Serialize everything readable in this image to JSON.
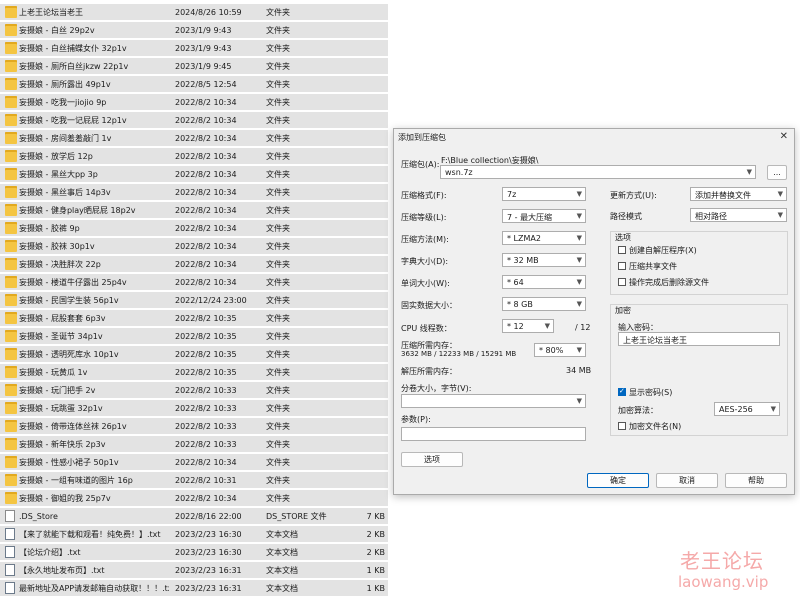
{
  "files": [
    {
      "icon": "folder",
      "name": "上老王论坛当老王",
      "date": "2024/8/26 10:59",
      "type": "文件夹",
      "size": ""
    },
    {
      "icon": "folder",
      "name": "妄摄娘 - 白丝 29p2v",
      "date": "2023/1/9 9:43",
      "type": "文件夹",
      "size": ""
    },
    {
      "icon": "folder",
      "name": "妄摄娘 - 白丝捕蝶女仆 32p1v",
      "date": "2023/1/9 9:43",
      "type": "文件夹",
      "size": ""
    },
    {
      "icon": "folder",
      "name": "妄摄娘 - 厕所白丝jkzw 22p1v",
      "date": "2023/1/9 9:45",
      "type": "文件夹",
      "size": ""
    },
    {
      "icon": "folder",
      "name": "妄摄娘 - 厕所露出 49p1v",
      "date": "2022/8/5 12:54",
      "type": "文件夹",
      "size": ""
    },
    {
      "icon": "folder",
      "name": "妄摄娘 - 吃我一jiojio 9p",
      "date": "2022/8/2 10:34",
      "type": "文件夹",
      "size": ""
    },
    {
      "icon": "folder",
      "name": "妄摄娘 - 吃我一记屁屁 12p1v",
      "date": "2022/8/2 10:34",
      "type": "文件夹",
      "size": ""
    },
    {
      "icon": "folder",
      "name": "妄摄娘 - 房间羞羞敲门 1v",
      "date": "2022/8/2 10:34",
      "type": "文件夹",
      "size": ""
    },
    {
      "icon": "folder",
      "name": "妄摄娘 - 放学后 12p",
      "date": "2022/8/2 10:34",
      "type": "文件夹",
      "size": ""
    },
    {
      "icon": "folder",
      "name": "妄摄娘 - 黑丝大pp 3p",
      "date": "2022/8/2 10:34",
      "type": "文件夹",
      "size": ""
    },
    {
      "icon": "folder",
      "name": "妄摄娘 - 黑丝事后 14p3v",
      "date": "2022/8/2 10:34",
      "type": "文件夹",
      "size": ""
    },
    {
      "icon": "folder",
      "name": "妄摄娘 - 健身play晒屁屁 18p2v",
      "date": "2022/8/2 10:34",
      "type": "文件夹",
      "size": ""
    },
    {
      "icon": "folder",
      "name": "妄摄娘 - 胶裤 9p",
      "date": "2022/8/2 10:34",
      "type": "文件夹",
      "size": ""
    },
    {
      "icon": "folder",
      "name": "妄摄娘 - 胶袜 30p1v",
      "date": "2022/8/2 10:34",
      "type": "文件夹",
      "size": ""
    },
    {
      "icon": "folder",
      "name": "妄摄娘 - 决胜胖次 22p",
      "date": "2022/8/2 10:34",
      "type": "文件夹",
      "size": ""
    },
    {
      "icon": "folder",
      "name": "妄摄娘 - 楼道牛仔露出 25p4v",
      "date": "2022/8/2 10:34",
      "type": "文件夹",
      "size": ""
    },
    {
      "icon": "folder",
      "name": "妄摄娘 - 民国学生装 56p1v",
      "date": "2022/12/24 23:00",
      "type": "文件夹",
      "size": ""
    },
    {
      "icon": "folder",
      "name": "妄摄娘 - 屁股套套 6p3v",
      "date": "2022/8/2 10:35",
      "type": "文件夹",
      "size": ""
    },
    {
      "icon": "folder",
      "name": "妄摄娘 - 圣诞节 34p1v",
      "date": "2022/8/2 10:35",
      "type": "文件夹",
      "size": ""
    },
    {
      "icon": "folder",
      "name": "妄摄娘 - 透明死库水 10p1v",
      "date": "2022/8/2 10:35",
      "type": "文件夹",
      "size": ""
    },
    {
      "icon": "folder",
      "name": "妄摄娘 - 玩黄瓜 1v",
      "date": "2022/8/2 10:35",
      "type": "文件夹",
      "size": ""
    },
    {
      "icon": "folder",
      "name": "妄摄娘 - 玩门把手 2v",
      "date": "2022/8/2 10:33",
      "type": "文件夹",
      "size": ""
    },
    {
      "icon": "folder",
      "name": "妄摄娘 - 玩跳蛋 32p1v",
      "date": "2022/8/2 10:33",
      "type": "文件夹",
      "size": ""
    },
    {
      "icon": "folder",
      "name": "妄摄娘 - 倚带连体丝袜 26p1v",
      "date": "2022/8/2 10:33",
      "type": "文件夹",
      "size": ""
    },
    {
      "icon": "folder",
      "name": "妄摄娘 - 新年快乐 2p3v",
      "date": "2022/8/2 10:33",
      "type": "文件夹",
      "size": ""
    },
    {
      "icon": "folder",
      "name": "妄摄娘 - 性感小裙子 50p1v",
      "date": "2022/8/2 10:34",
      "type": "文件夹",
      "size": ""
    },
    {
      "icon": "folder",
      "name": "妄摄娘 - 一组有味道的图片 16p",
      "date": "2022/8/2 10:31",
      "type": "文件夹",
      "size": ""
    },
    {
      "icon": "folder",
      "name": "妄摄娘 - 御姐的我 25p7v",
      "date": "2022/8/2 10:34",
      "type": "文件夹",
      "size": ""
    },
    {
      "icon": "file",
      "name": ".DS_Store",
      "date": "2022/8/16 22:00",
      "type": "DS_STORE 文件",
      "size": "7 KB"
    },
    {
      "icon": "txt",
      "name": "【来了就能下载和观看！纯免费！】.txt",
      "date": "2023/2/23 16:30",
      "type": "文本文档",
      "size": "2 KB"
    },
    {
      "icon": "txt",
      "name": "【论坛介绍】.txt",
      "date": "2023/2/23 16:30",
      "type": "文本文档",
      "size": "2 KB"
    },
    {
      "icon": "txt",
      "name": "【永久地址发布页】.txt",
      "date": "2023/2/23 16:31",
      "type": "文本文档",
      "size": "1 KB"
    },
    {
      "icon": "txt",
      "name": "最新地址及APP请发邮箱自动获取！！！.txt",
      "date": "2023/2/23 16:31",
      "type": "文本文档",
      "size": "1 KB"
    }
  ],
  "dialog": {
    "title": "添加到压缩包",
    "close": "✕",
    "archive_label": "压缩包(A):",
    "archive_path": "F:\\Blue collection\\妄摄娘\\",
    "archive_name": "wsn.7z",
    "browse": "...",
    "format_label": "压缩格式(F):",
    "format_value": "7z",
    "level_label": "压缩等级(L):",
    "level_value": "7 - 最大压缩",
    "method_label": "压缩方法(M):",
    "method_value": "* LZMA2",
    "dict_label": "字典大小(D):",
    "dict_value": "* 32 MB",
    "word_label": "单词大小(W):",
    "word_value": "* 64",
    "solid_label": "固实数据大小：",
    "solid_value": "* 8 GB",
    "cpu_label": "CPU 线程数：",
    "cpu_value": "* 12",
    "cpu_total": "/ 12",
    "mem_label": "压缩所需内存：",
    "mem_detail": "3632 MB / 12233 MB / 15291 MB",
    "mem_percent": "* 80%",
    "decomp_label": "解压所需内存：",
    "decomp_value": "34 MB",
    "split_label": "分卷大小，字节(V):",
    "split_value": "",
    "params_label": "参数(P):",
    "params_value": "",
    "options_button": "选项",
    "update_label": "更新方式(U):",
    "update_value": "添加并替换文件",
    "path_label": "路径模式",
    "path_value": "相对路径",
    "options_group": "选项",
    "opt_sfx": "创建自解压程序(X)",
    "opt_shared": "压缩共享文件",
    "opt_delete": "操作完成后删除源文件",
    "encrypt_group": "加密",
    "password_label": "输入密码：",
    "password_value": "上老王论坛当老王",
    "show_password": "显示密码(S)",
    "enc_method_label": "加密算法：",
    "enc_method_value": "AES-256",
    "enc_names": "加密文件名(N)",
    "ok": "确定",
    "cancel": "取消",
    "help": "帮助"
  },
  "watermark": {
    "line1": "老王论坛",
    "line2": "laowang.vip"
  }
}
